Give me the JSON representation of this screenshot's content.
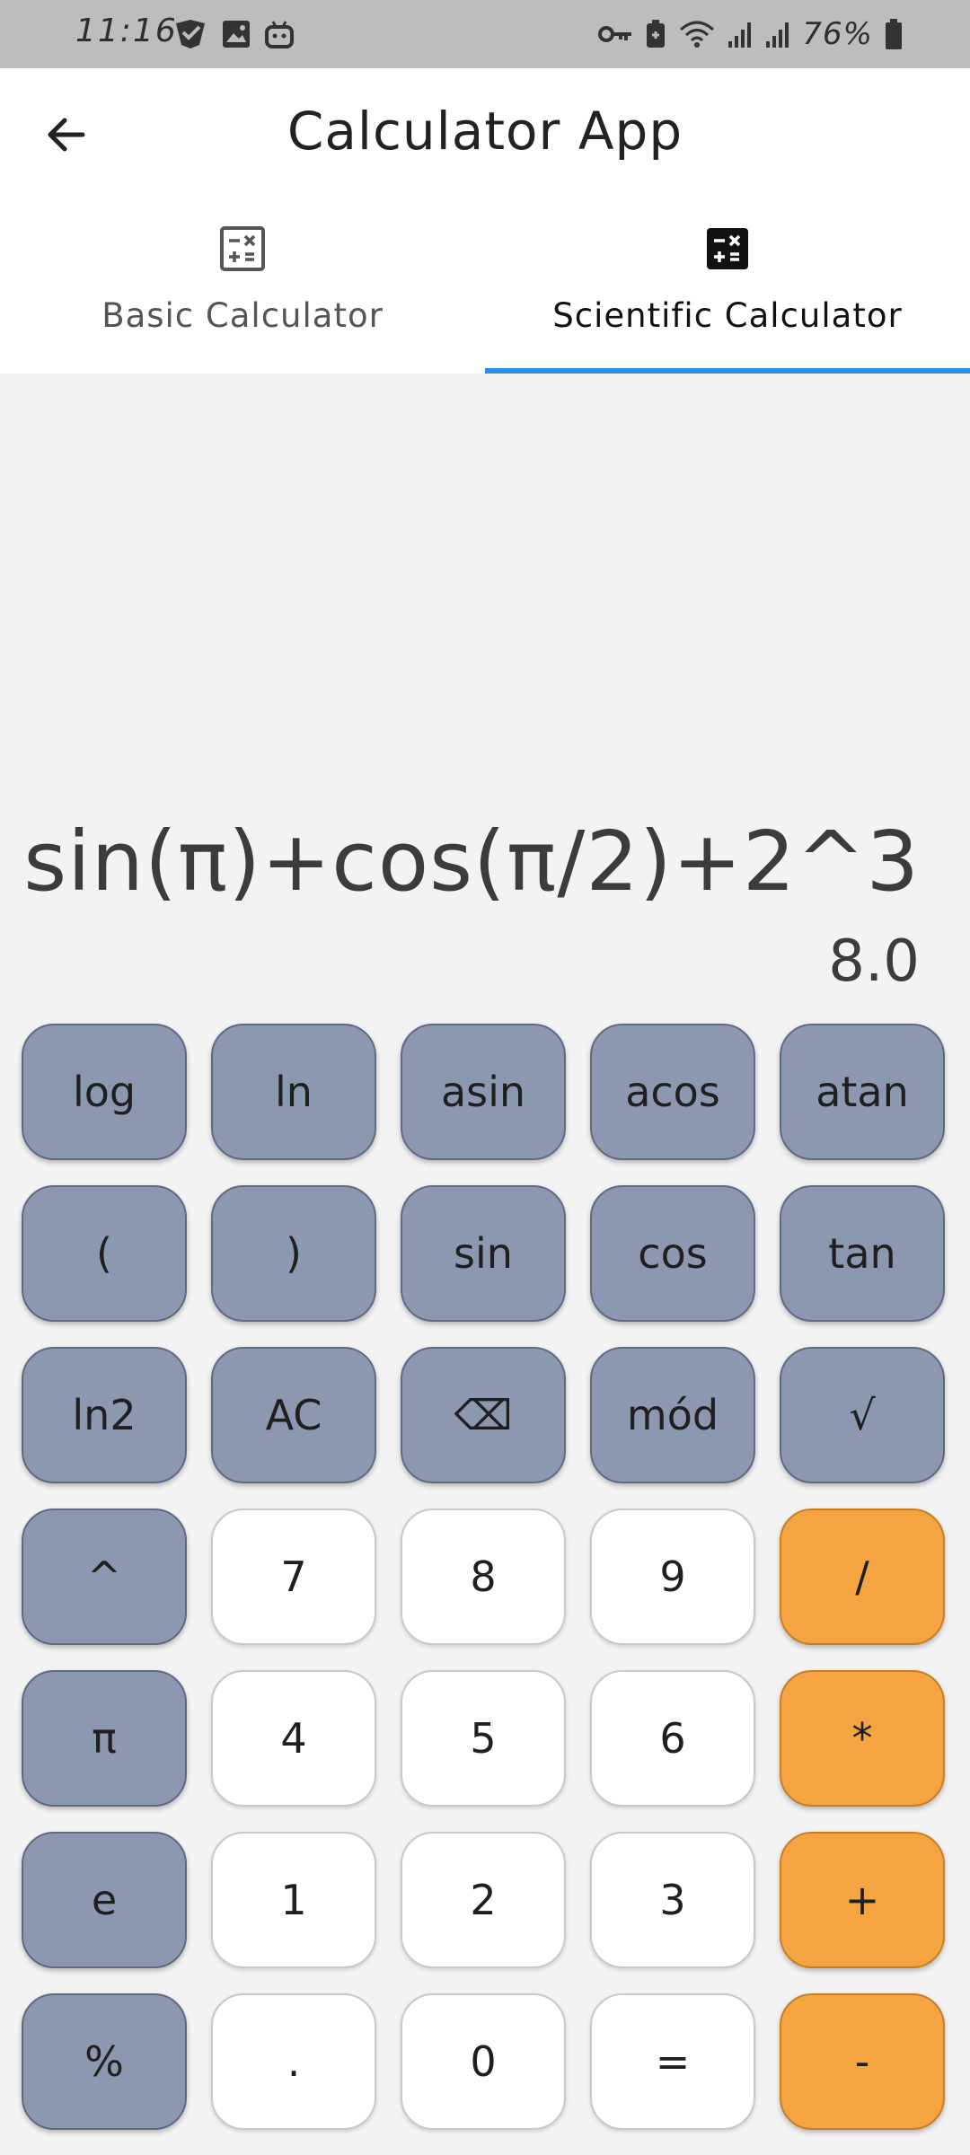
{
  "status_bar": {
    "time": "11:16",
    "battery_percent": "76%",
    "left_icons": [
      "check-badge-icon",
      "image-icon",
      "robot-icon"
    ],
    "right_icons": [
      "key-icon",
      "battery-saver-icon",
      "wifi-icon",
      "signal-icon",
      "signal-icon",
      "battery-icon"
    ]
  },
  "app_bar": {
    "title": "Calculator App"
  },
  "tabs": [
    {
      "label": "Basic Calculator",
      "icon": "calculator-outline-icon",
      "active": false
    },
    {
      "label": "Scientific Calculator",
      "icon": "calculator-filled-icon",
      "active": true
    }
  ],
  "display": {
    "expression": "sin(π)+cos(π/2)+2^3",
    "result": "8.0"
  },
  "keypad": {
    "rows": [
      [
        {
          "label": "log",
          "type": "fn",
          "name": "log-key"
        },
        {
          "label": "ln",
          "type": "fn",
          "name": "ln-key"
        },
        {
          "label": "asin",
          "type": "fn",
          "name": "asin-key"
        },
        {
          "label": "acos",
          "type": "fn",
          "name": "acos-key"
        },
        {
          "label": "atan",
          "type": "fn",
          "name": "atan-key"
        }
      ],
      [
        {
          "label": "(",
          "type": "fn",
          "name": "open-paren-key"
        },
        {
          "label": ")",
          "type": "fn",
          "name": "close-paren-key"
        },
        {
          "label": "sin",
          "type": "fn",
          "name": "sin-key"
        },
        {
          "label": "cos",
          "type": "fn",
          "name": "cos-key"
        },
        {
          "label": "tan",
          "type": "fn",
          "name": "tan-key"
        }
      ],
      [
        {
          "label": "ln2",
          "type": "fn",
          "name": "ln2-key"
        },
        {
          "label": "AC",
          "type": "fn",
          "name": "all-clear-key"
        },
        {
          "label": "⌫",
          "type": "fn",
          "name": "backspace-key"
        },
        {
          "label": "mód",
          "type": "fn",
          "name": "mod-key"
        },
        {
          "label": "√",
          "type": "fn",
          "name": "sqrt-key"
        }
      ],
      [
        {
          "label": "^",
          "type": "fn",
          "name": "power-key"
        },
        {
          "label": "7",
          "type": "num",
          "name": "digit-7-key"
        },
        {
          "label": "8",
          "type": "num",
          "name": "digit-8-key"
        },
        {
          "label": "9",
          "type": "num",
          "name": "digit-9-key"
        },
        {
          "label": "/",
          "type": "op",
          "name": "divide-key"
        }
      ],
      [
        {
          "label": "π",
          "type": "fn",
          "name": "pi-key"
        },
        {
          "label": "4",
          "type": "num",
          "name": "digit-4-key"
        },
        {
          "label": "5",
          "type": "num",
          "name": "digit-5-key"
        },
        {
          "label": "6",
          "type": "num",
          "name": "digit-6-key"
        },
        {
          "label": "*",
          "type": "op",
          "name": "multiply-key"
        }
      ],
      [
        {
          "label": "e",
          "type": "fn",
          "name": "euler-key"
        },
        {
          "label": "1",
          "type": "num",
          "name": "digit-1-key"
        },
        {
          "label": "2",
          "type": "num",
          "name": "digit-2-key"
        },
        {
          "label": "3",
          "type": "num",
          "name": "digit-3-key"
        },
        {
          "label": "+",
          "type": "op",
          "name": "plus-key"
        }
      ],
      [
        {
          "label": "%",
          "type": "fn",
          "name": "percent-key"
        },
        {
          "label": ".",
          "type": "num",
          "name": "decimal-key"
        },
        {
          "label": "0",
          "type": "num",
          "name": "digit-0-key"
        },
        {
          "label": "=",
          "type": "num",
          "name": "equals-key"
        },
        {
          "label": "-",
          "type": "op",
          "name": "minus-key"
        }
      ]
    ]
  },
  "colors": {
    "function_key": "#8b98b0",
    "number_key": "#ffffff",
    "operator_key": "#f5a442",
    "tab_indicator": "#2b8ee4",
    "background": "#f3f3f3"
  }
}
